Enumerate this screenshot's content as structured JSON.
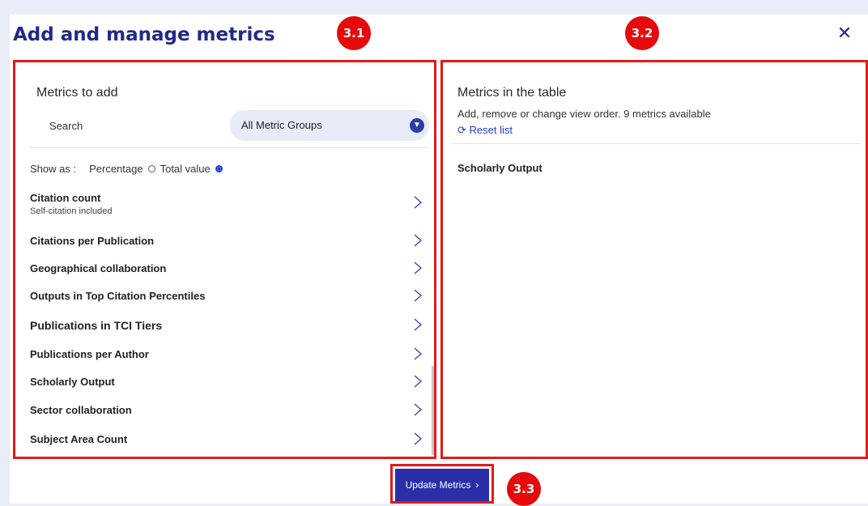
{
  "dialog": {
    "title": "Add and manage metrics",
    "close_icon": "close-icon"
  },
  "annotations": [
    "3.1",
    "3.2",
    "3.3"
  ],
  "left_panel": {
    "title": "Metrics to add",
    "search_label": "Search",
    "group_select": "All Metric Groups",
    "show_as": {
      "label": "Show as :",
      "options": [
        {
          "label": "Percentage",
          "selected": false
        },
        {
          "label": "Total value",
          "selected": true
        }
      ]
    },
    "metrics": [
      {
        "name": "Citation count",
        "sub": "Self-citation included"
      },
      {
        "name": "Citations per Publication"
      },
      {
        "name": "Geographical collaboration"
      },
      {
        "name": "Outputs in Top Citation Percentiles"
      },
      {
        "name": "Publications in TCI Tiers"
      },
      {
        "name": "Publications per Author"
      },
      {
        "name": "Scholarly Output"
      },
      {
        "name": "Sector collaboration"
      },
      {
        "name": "Subject Area Count"
      }
    ]
  },
  "right_panel": {
    "title": "Metrics in the table",
    "subtitle": "Add, remove or change view order. 9 metrics available",
    "reset_label": "Reset list",
    "items": [
      "Scholarly Output"
    ]
  },
  "footer": {
    "update_label": "Update Metrics"
  },
  "colors": {
    "brand": "#1f2a8a",
    "accent": "#1f3fd1",
    "annotation_red": "#e21b1b",
    "button": "#2a2fa8"
  }
}
